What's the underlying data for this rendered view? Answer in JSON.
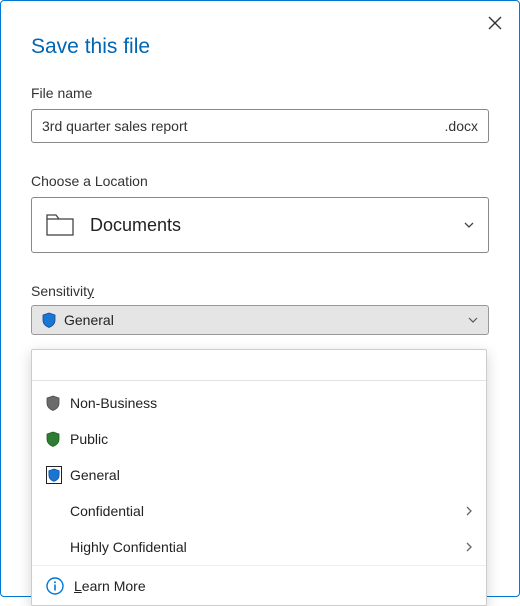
{
  "dialog": {
    "title": "Save this file",
    "filename_label": "File name",
    "filename_value": "3rd quarter sales report",
    "extension": ".docx",
    "location_label": "Choose a Location",
    "location_value": "Documents",
    "sensitivity_label_pre": "Sensitivit",
    "sensitivity_label_u": "y",
    "sensitivity_selected": "General"
  },
  "sensitivity_dropdown": {
    "items": [
      {
        "label": "Non-Business",
        "shield_color": "#6b6b6b",
        "has_submenu": false,
        "selected": false
      },
      {
        "label": "Public",
        "shield_color": "#2f7d32",
        "has_submenu": false,
        "selected": false
      },
      {
        "label": "General",
        "shield_color": "#1976d2",
        "has_submenu": false,
        "selected": true
      },
      {
        "label": "Confidential",
        "shield_color": "",
        "has_submenu": true,
        "selected": false
      },
      {
        "label": "Highly Confidential",
        "shield_color": "",
        "has_submenu": true,
        "selected": false
      }
    ],
    "learn_more_pre": "L",
    "learn_more_rest": "earn More"
  },
  "colors": {
    "accent": "#0066b4"
  }
}
